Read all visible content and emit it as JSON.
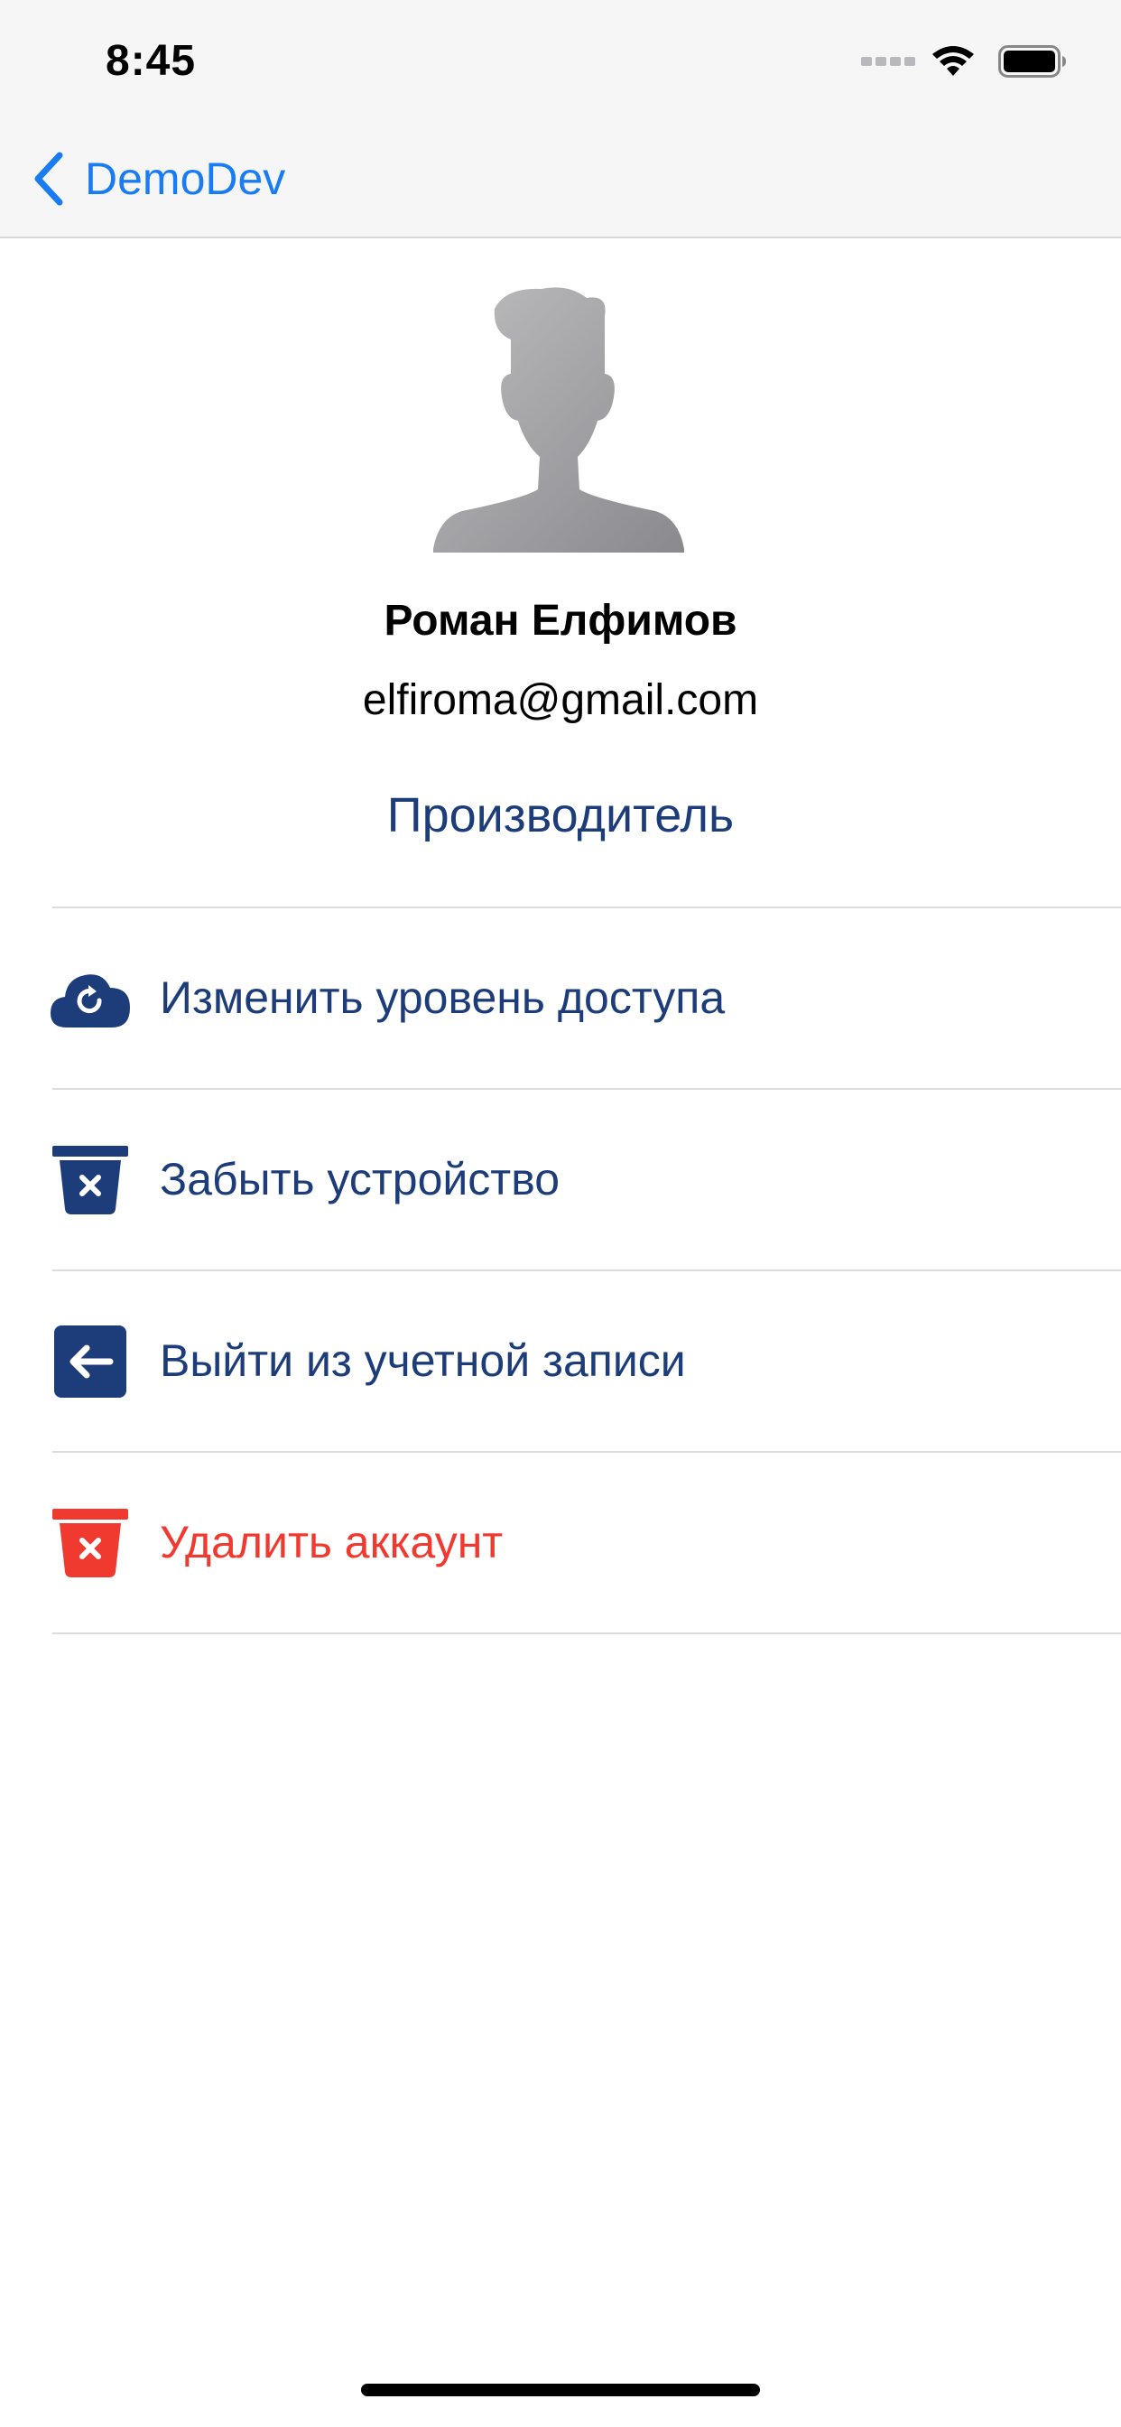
{
  "status_bar": {
    "time": "8:45"
  },
  "nav": {
    "back_label": "DemoDev"
  },
  "profile": {
    "name": "Роман Елфимов",
    "email": "elfiroma@gmail.com",
    "role": "Производитель"
  },
  "menu": [
    {
      "label": "Изменить уровень доступа",
      "icon": "cloud-refresh-icon",
      "color": "#1d3d7a"
    },
    {
      "label": "Забыть устройство",
      "icon": "bin-x-icon",
      "color": "#1d3d7a"
    },
    {
      "label": "Выйти из учетной записи",
      "icon": "arrow-left-square-icon",
      "color": "#1d3d7a"
    },
    {
      "label": "Удалить аккаунт",
      "icon": "bin-x-icon",
      "color": "#f03a30"
    }
  ],
  "colors": {
    "accent_blue": "#1a7cf5",
    "primary_navy": "#1d3d7a",
    "danger_red": "#f03a30"
  }
}
